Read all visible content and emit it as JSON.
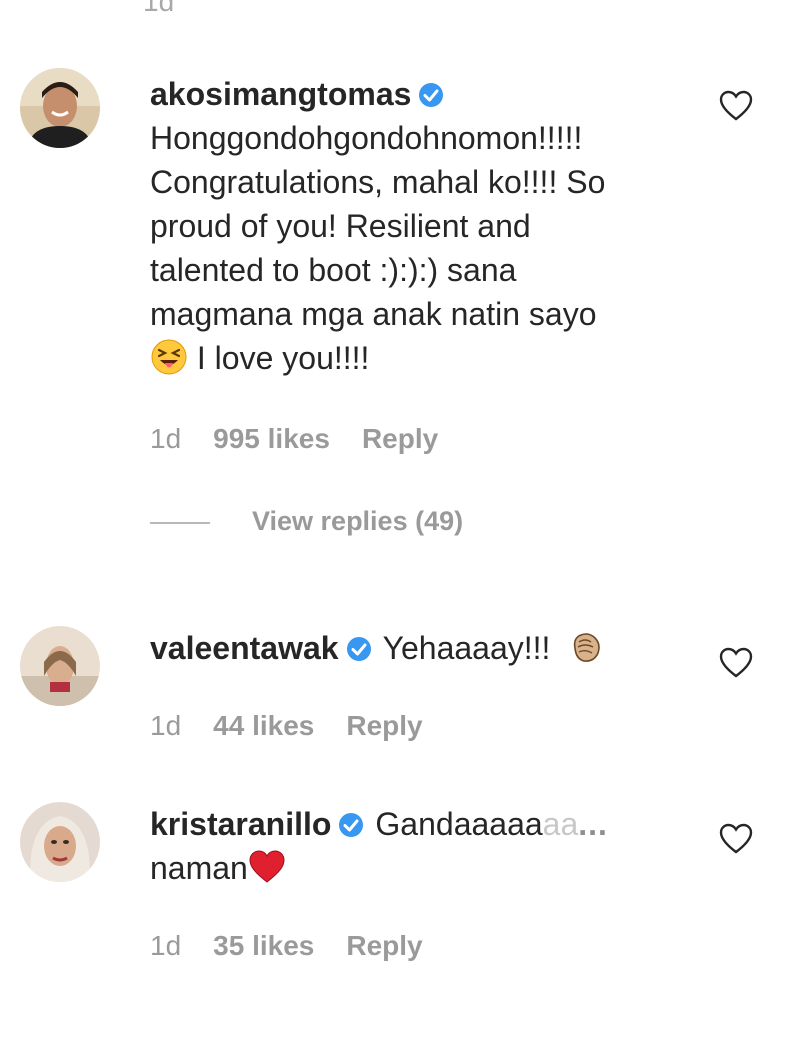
{
  "top_fragment": "1d",
  "comments": [
    {
      "username": "akosimangtomas",
      "verified": true,
      "text_lines": [
        "Honggondohgondohnomon!!!!!",
        "Congratulations, mahal ko!!!! So",
        "proud of you! Resilient and",
        "talented to boot :):):) sana",
        "magmana mga anak natin sayo"
      ],
      "last_line_text": " I love you!!!!",
      "emoji": "squinting-tongue-emoji",
      "time": "1d",
      "likes": "995 likes",
      "reply_label": "Reply",
      "view_replies": "View replies (49)"
    },
    {
      "username": "valeentawak",
      "verified": true,
      "text": "Yehaaaay!!!",
      "emoji": "clapping-hands-emoji",
      "time": "1d",
      "likes": "44 likes",
      "reply_label": "Reply"
    },
    {
      "username": "kristaranillo",
      "verified": true,
      "text_start": "Gandaaaaa",
      "text_faded": "aa",
      "more": "...",
      "line2": "naman",
      "emoji": "red-heart-emoji",
      "time": "1d",
      "likes": "35 likes",
      "reply_label": "Reply"
    }
  ],
  "colors": {
    "text": "#262626",
    "muted": "#9a9a9a",
    "verified_blue": "#3897f0",
    "heart_red": "#e0202f"
  }
}
